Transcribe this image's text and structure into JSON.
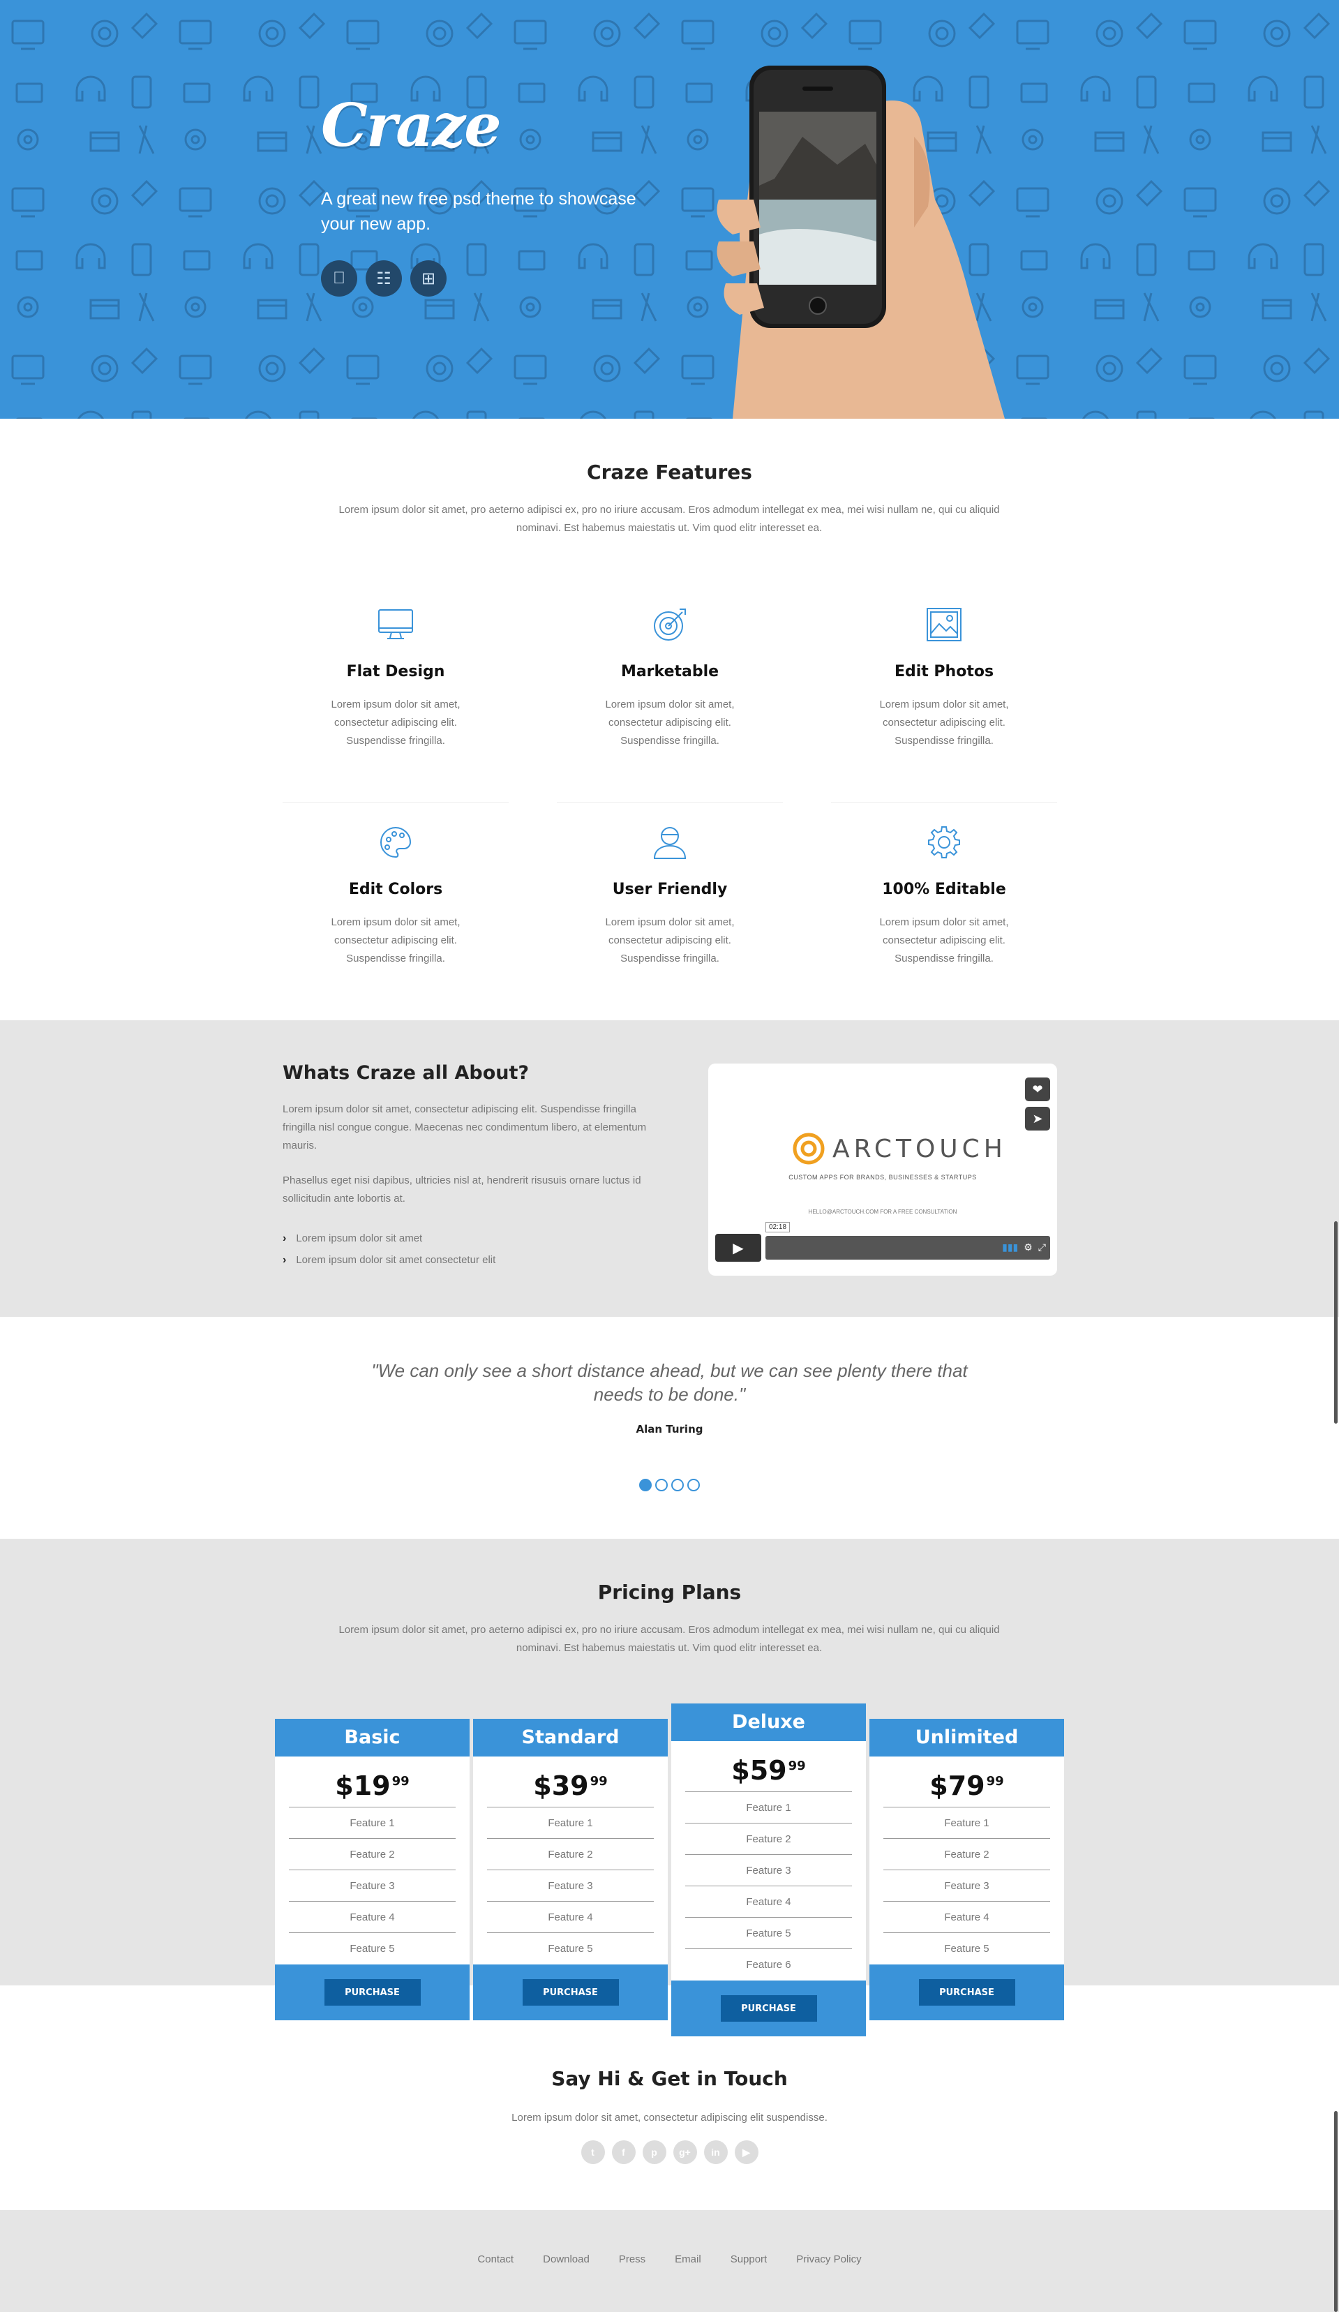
{
  "hero": {
    "logo": "Craze",
    "tagline": "A great new free psd theme to showcase your new app.",
    "store_icons": [
      "apple-icon",
      "android-icon",
      "windows-icon"
    ],
    "bg_color": "#3a93d9"
  },
  "features": {
    "title": "Craze Features",
    "intro": "Lorem ipsum dolor sit amet, pro aeterno adipisci ex, pro no iriure accusam. Eros admodum intellegat ex mea, mei wisi nullam ne, qui cu aliquid nominavi. Est habemus maiestatis ut. Vim quod elitr interesset ea.",
    "items": [
      {
        "icon": "monitor-icon",
        "title": "Flat Design",
        "text": "Lorem ipsum dolor sit amet, consectetur adipiscing elit. Suspendisse fringilla."
      },
      {
        "icon": "target-icon",
        "title": "Marketable",
        "text": "Lorem ipsum dolor sit amet, consectetur adipiscing elit. Suspendisse fringilla."
      },
      {
        "icon": "image-icon",
        "title": "Edit Photos",
        "text": "Lorem ipsum dolor sit amet, consectetur adipiscing elit. Suspendisse fringilla."
      },
      {
        "icon": "palette-icon",
        "title": "Edit Colors",
        "text": "Lorem ipsum dolor sit amet, consectetur adipiscing elit. Suspendisse fringilla."
      },
      {
        "icon": "user-icon",
        "title": "User Friendly",
        "text": "Lorem ipsum dolor sit amet, consectetur adipiscing elit. Suspendisse fringilla."
      },
      {
        "icon": "gear-icon",
        "title": "100% Editable",
        "text": "Lorem ipsum dolor sit amet, consectetur adipiscing elit. Suspendisse fringilla."
      }
    ]
  },
  "about": {
    "title": "Whats Craze all About?",
    "p1": "Lorem ipsum dolor sit amet, consectetur adipiscing elit. Suspendisse fringilla fringilla nisl congue congue. Maecenas nec condimentum libero, at elementum mauris.",
    "p2": "Phasellus eget nisi dapibus, ultricies nisl at, hendrerit risusuis ornare luctus id sollicitudin ante lobortis at.",
    "list": [
      "Lorem ipsum dolor sit amet",
      "Lorem ipsum dolor sit amet consectetur elit"
    ],
    "video": {
      "brand": "ARCTOUCH",
      "subtitle": "CUSTOM APPS FOR BRANDS, BUSINESSES & STARTUPS",
      "contact": "HELLO@ARCTOUCH.COM FOR A FREE CONSULTATION",
      "time": "02:18"
    }
  },
  "quote": {
    "text": "\"We can only see a short distance ahead, but we can see plenty there that needs to be done.\"",
    "author": "Alan Turing",
    "dots": 4,
    "active_dot": 0
  },
  "pricing": {
    "title": "Pricing Plans",
    "intro": "Lorem ipsum dolor sit amet, pro aeterno adipisci ex, pro no iriure accusam. Eros admodum intellegat ex mea, mei wisi nullam ne, qui cu aliquid nominavi. Est habemus maiestatis ut. Vim quod elitr interesset ea.",
    "plans": [
      {
        "name": "Basic",
        "price": "$19",
        "cents": "99",
        "features": [
          "Feature 1",
          "Feature 2",
          "Feature 3",
          "Feature 4",
          "Feature 5"
        ],
        "button": "PURCHASE"
      },
      {
        "name": "Standard",
        "price": "$39",
        "cents": "99",
        "features": [
          "Feature 1",
          "Feature 2",
          "Feature 3",
          "Feature 4",
          "Feature 5"
        ],
        "button": "PURCHASE"
      },
      {
        "name": "Deluxe",
        "price": "$59",
        "cents": "99",
        "features": [
          "Feature 1",
          "Feature 2",
          "Feature 3",
          "Feature 4",
          "Feature 5",
          "Feature 6"
        ],
        "button": "PURCHASE"
      },
      {
        "name": "Unlimited",
        "price": "$79",
        "cents": "99",
        "features": [
          "Feature 1",
          "Feature 2",
          "Feature 3",
          "Feature 4",
          "Feature 5"
        ],
        "button": "PURCHASE"
      }
    ]
  },
  "contact": {
    "title": "Say Hi & Get in Touch",
    "text": "Lorem ipsum dolor sit amet, consectetur adipiscing elit suspendisse.",
    "socials": [
      "twitter-icon",
      "facebook-icon",
      "pinterest-icon",
      "googleplus-icon",
      "linkedin-icon",
      "youtube-icon"
    ]
  },
  "footer": {
    "links": [
      "Contact",
      "Download",
      "Press",
      "Email",
      "Support",
      "Privacy Policy"
    ]
  }
}
